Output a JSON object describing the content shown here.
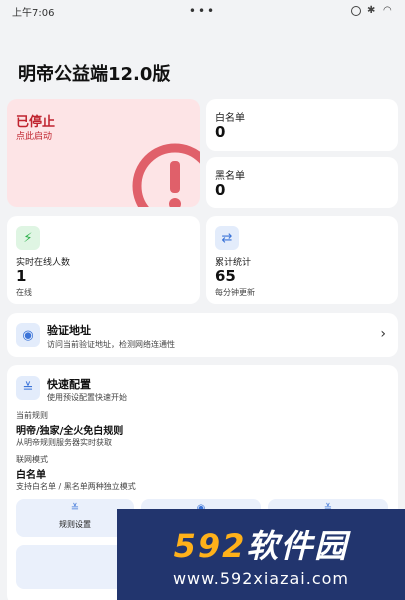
{
  "status_bar": {
    "time": "上午7:06",
    "dots": "•••"
  },
  "header": {
    "title": "明帝公益端12.0版"
  },
  "status_card": {
    "title": "已停止",
    "subtitle": "点此启动",
    "accent": "#c0242f",
    "background": "#fde4e6"
  },
  "whitelist": {
    "label": "白名单",
    "value": "0"
  },
  "blacklist": {
    "label": "黑名单",
    "value": "0"
  },
  "online": {
    "icon": "bolt-icon",
    "label": "实时在线人数",
    "value": "1",
    "note": "在线"
  },
  "stats": {
    "icon": "swap-icon",
    "label": "累计统计",
    "value": "65",
    "note": "每分钟更新"
  },
  "verify": {
    "icon": "globe-icon",
    "title": "验证地址",
    "subtitle": "访问当前验证地址，检测网络连通性"
  },
  "quick_config": {
    "icon": "sliders-icon",
    "title": "快速配置",
    "subtitle": "使用预设配置快速开始",
    "rule_section": "当前规则",
    "rule_value": "明帝/独家/全火免白规则",
    "rule_desc": "从明帝规则服务器实时获取",
    "mode_section": "联网模式",
    "mode_value": "白名单",
    "mode_desc": "支持白名单 / 黑名单两种独立模式",
    "tiles": [
      {
        "label": "规则设置"
      }
    ]
  },
  "watermark": {
    "brand_num": "592",
    "brand_text": "软件园",
    "url": "www.592xiazai.com"
  }
}
